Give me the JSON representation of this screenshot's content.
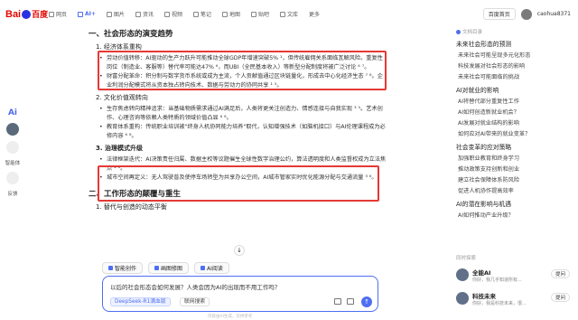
{
  "logo": {
    "bai": "Bai",
    "du": "百度"
  },
  "nav": [
    {
      "label": "网页",
      "active": false
    },
    {
      "label": "AI+",
      "active": true
    },
    {
      "label": "图片",
      "active": false
    },
    {
      "label": "资讯",
      "active": false
    },
    {
      "label": "视频",
      "active": false
    },
    {
      "label": "笔记",
      "active": false
    },
    {
      "label": "地图",
      "active": false
    },
    {
      "label": "贴吧",
      "active": false
    },
    {
      "label": "文库",
      "active": false
    },
    {
      "label": "更多",
      "active": false
    }
  ],
  "topright": {
    "home": "百度首页",
    "user": "caohua8371"
  },
  "rail": {
    "ai": "Ai",
    "item1": "智能体",
    "item2": "反馈"
  },
  "content": {
    "h1": "一、社会形态的演变趋势",
    "s1": "1. 经济体系重构",
    "b1": "劳动价值转移：AI驱动的生产力跃升可能推动全球GDP年增速突破5% ¹，但传统雇佣关系面临瓦解风险。重复性岗位（制造业、客服等）替代率可能达47% ⁶，而UBI（全民基本收入）等新型分配制度将被广泛讨论 ⁶ ⁷。",
    "b2": "财富分配革命：积分制与数字货币系统或成为主流，个人贡献值通过区块链量化，形成去中心化经济生态 ⁷ ⁸。企业利润分配模式将从资本独占转向技术、数据与劳动力的协同共享 ¹ ⁵。",
    "s2": "2. 文化价值观转向",
    "b3": "生存焦虑转向精神追求：当基础物质需求通过AI满足后，人类将更关注创造力、情感连接与自我实现 ³ ⁵。艺术创作、心理咨询等依赖人类特质的领域价值凸显 ⁶ ⁸。",
    "b4": "教育体系重构：传统职业培训被\"终身人机协同能力培养\"取代，认知增强技术（如脑机接口）与AI伦理课程成为必修内容 ⁶ ⁸。",
    "s3": "3. 治理模式升级",
    "b5": "法律框架迭代：AI决策责任归属、数据主权等议题催生全球性数字治理公约，算法透明度和人类监督权成为立法焦点 ¹ ⁶。",
    "b6": "城市空间再定义：无人驾驶普及使停车场转型为共享办公空间，AI城市管家实时优化能源分配与交通流量 ³ ⁶。",
    "h2": "二、工作形态的颠覆与重生",
    "s4": "1. 替代与创造的动态平衡"
  },
  "chips": [
    "智能创作",
    "画图修图",
    "AI阅读"
  ],
  "input": {
    "prompt": "以后的社会形态会如何发展？人类会因为AI的出现而不用工作吗？",
    "model": "DeepSeek-R1满血版",
    "websearch": "联网搜索"
  },
  "footnote": "内容由AI生成，仅供参考",
  "sidebar": {
    "caption": "文档目录",
    "groups": [
      {
        "title": "未来社会形态的预测",
        "items": [
          "未来社会可能呈现多元化形态",
          "科技发展对社会形态的影响",
          "未来社会可能面临的挑战"
        ]
      },
      {
        "title": "AI对就业的影响",
        "items": [
          "AI将替代部分重复性工作",
          "AI如何创造新就业机会？",
          "AI发展对就业结构的影响",
          "如何应对AI带来的就业变革？"
        ]
      },
      {
        "title": "社会变革的应对策略",
        "items": [
          "加强职业教育和终身学习",
          "推动政策支持创新和创业",
          "建立社会保障体系防风险",
          "促进人机协作提高效率"
        ]
      },
      {
        "title": "AI的潜在影响与机遇",
        "items": [
          "AI如何推动产业升级？"
        ]
      }
    ]
  },
  "recommend": {
    "caption": "同时探索",
    "items": [
      {
        "name": "全能AI",
        "desc": "你好，我几乎知道所有...",
        "ask": "提问"
      },
      {
        "name": "科技未来",
        "desc": "你好，我是科技未来，很...",
        "ask": "提问"
      }
    ]
  },
  "colors": {
    "accent": "#4e6ef2",
    "highlight": "#e53935",
    "brand": "#e10601"
  }
}
